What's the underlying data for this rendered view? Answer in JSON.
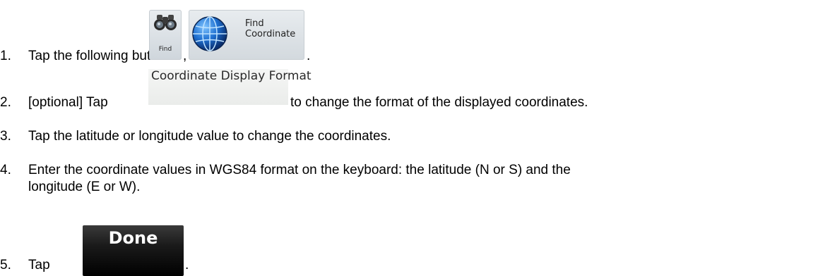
{
  "steps": [
    {
      "num": "1.",
      "text": "Tap the following buttons:",
      "sep": ",",
      "end": "."
    },
    {
      "num": "2.",
      "text_before": "[optional] Tap",
      "text_after": "to change the format of the displayed coordinates."
    },
    {
      "num": "3.",
      "text": "Tap the latitude or longitude value to change the coordinates."
    },
    {
      "num": "4.",
      "line1": "Enter the coordinate values in WGS84 format on the keyboard: the latitude (N or S) and the",
      "line2": "longitude (E or W)."
    },
    {
      "num": "5.",
      "text": "Tap",
      "end": "."
    }
  ],
  "buttons": {
    "find": {
      "label": "Find",
      "icon": "binoculars-icon"
    },
    "find_coordinate": {
      "label_line1": "Find",
      "label_line2": "Coordinate",
      "icon": "globe-icon"
    },
    "coordinate_display_format": {
      "label": "Coordinate Display Format"
    },
    "done": {
      "label": "Done"
    }
  }
}
